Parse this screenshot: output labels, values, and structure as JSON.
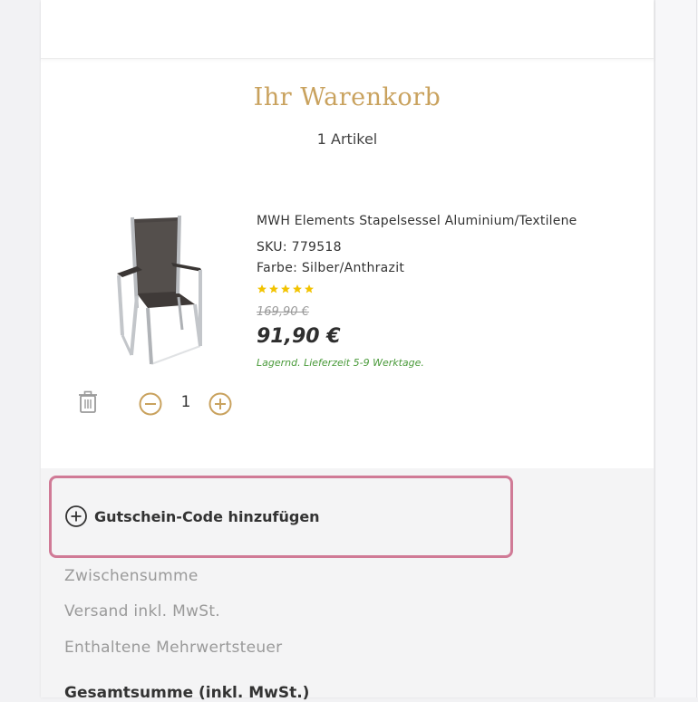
{
  "cart": {
    "title": "Ihr Warenkorb",
    "count": "1 Artikel"
  },
  "product": {
    "name": "MWH Elements Stapelsessel Aluminium/Textilene",
    "sku": "SKU: 779518",
    "color": "Farbe: Silber/Anthrazit",
    "rating": 5,
    "rating_max": 5,
    "old_price": "169,90 €",
    "new_price": "91,90 €",
    "delivery": "Lagernd. Lieferzeit 5-9 Werktage.",
    "quantity": "1"
  },
  "coupon": {
    "label": "Gutschein-Code hinzufügen"
  },
  "summary": {
    "subtotal_label": "Zwischensumme",
    "shipping_label": "Versand inkl. MwSt.",
    "tax_label": "Enthaltene Mehrwertsteuer",
    "total_label": "Gesamtsumme (inkl. MwSt.)"
  },
  "icons": {
    "trash": "trash-icon",
    "minus": "minus-circle-icon",
    "plus": "plus-circle-icon",
    "coupon": "plus-circle-icon",
    "star": "star-icon"
  },
  "colors": {
    "accent_gold": "#c9a25e",
    "star_yellow": "#f2c300",
    "delivery_green": "#4a9a3a",
    "highlight_pink": "#d07a96"
  }
}
